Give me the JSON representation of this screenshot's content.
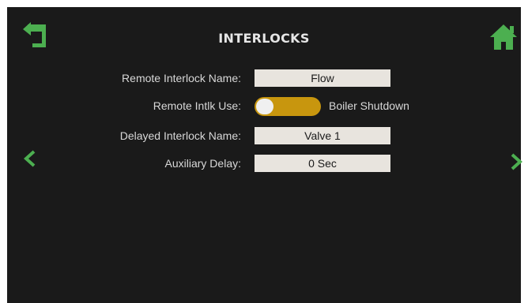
{
  "header": {
    "title": "INTERLOCKS",
    "back_icon": "back-arrow-icon",
    "home_icon": "home-icon"
  },
  "nav": {
    "prev_icon": "chevron-left-icon",
    "next_icon": "chevron-right-icon"
  },
  "fields": {
    "remote_interlock_name": {
      "label": "Remote Interlock Name:",
      "value": "Flow"
    },
    "remote_intlk_use": {
      "label": "Remote Intlk Use:",
      "toggle_text": "Boiler Shutdown",
      "on": true
    },
    "delayed_interlock_name": {
      "label": "Delayed Interlock Name:",
      "value": "Valve 1"
    },
    "auxiliary_delay": {
      "label": "Auxiliary Delay:",
      "value": "0 Sec"
    }
  },
  "colors": {
    "accent_green": "#4caf50",
    "toggle_gold": "#c8960e",
    "background": "#1a1a1a",
    "field_bg": "#e8e4de"
  }
}
